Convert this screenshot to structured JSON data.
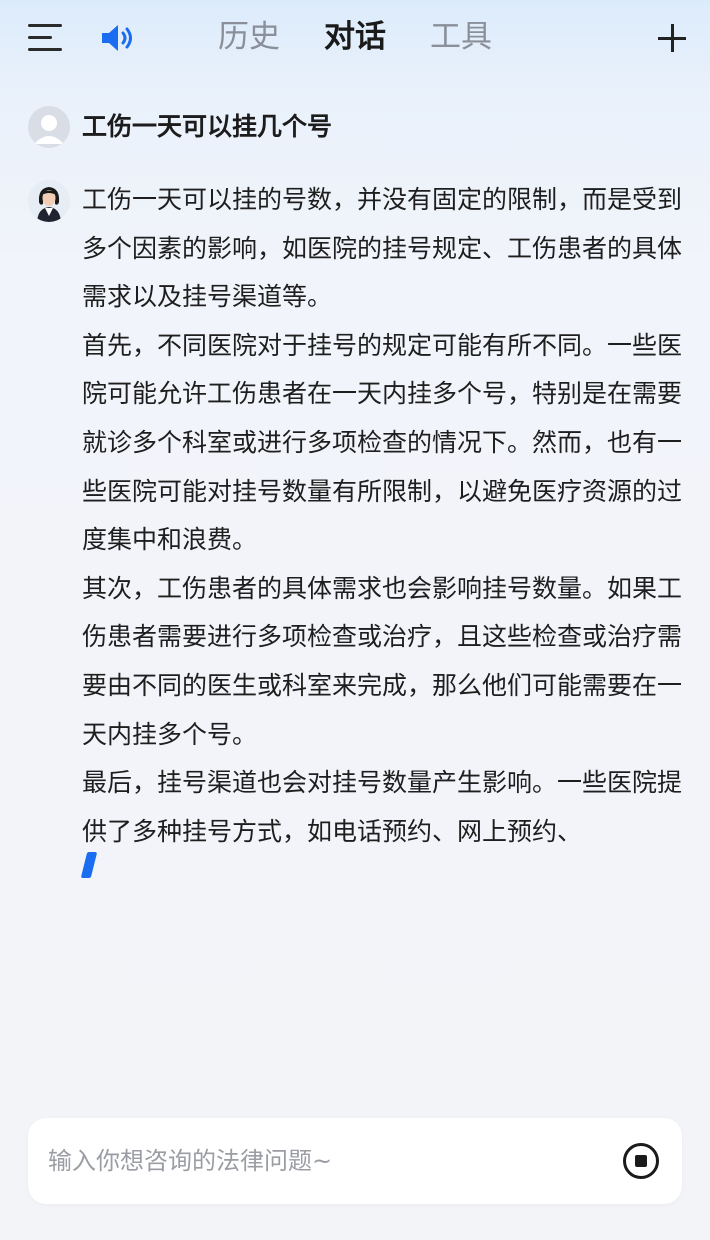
{
  "header": {
    "menu_icon": "hamburger-menu-icon",
    "speaker_icon": "speaker-volume-icon",
    "tabs": [
      {
        "label": "历史",
        "active": false
      },
      {
        "label": "对话",
        "active": true
      },
      {
        "label": "工具",
        "active": false
      }
    ],
    "plus_icon": "plus-icon"
  },
  "conversation": {
    "user_question": "工伤一天可以挂几个号",
    "answer_paragraphs": [
      "工伤一天可以挂的号数，并没有固定的限制，而是受到多个因素的影响，如医院的挂号规定、工伤患者的具体需求以及挂号渠道等。",
      "首先，不同医院对于挂号的规定可能有所不同。一些医院可能允许工伤患者在一天内挂多个号，特别是在需要就诊多个科室或进行多项检查的情况下。然而，也有一些医院可能对挂号数量有所限制，以避免医疗资源的过度集中和浪费。",
      "其次，工伤患者的具体需求也会影响挂号数量。如果工伤患者需要进行多项检查或治疗，且这些检查或治疗需要由不同的医生或科室来完成，那么他们可能需要在一天内挂多个号。",
      "最后，挂号渠道也会对挂号数量产生影响。一些医院提供了多种挂号方式，如电话预约、网上预约、"
    ]
  },
  "input": {
    "placeholder": "输入你想咨询的法律问题~",
    "value": "",
    "stop_icon": "stop-generation-icon"
  },
  "colors": {
    "accent_blue": "#1a6df0",
    "active_tab": "#1a1a1a",
    "inactive_tab": "#8a8f99"
  }
}
